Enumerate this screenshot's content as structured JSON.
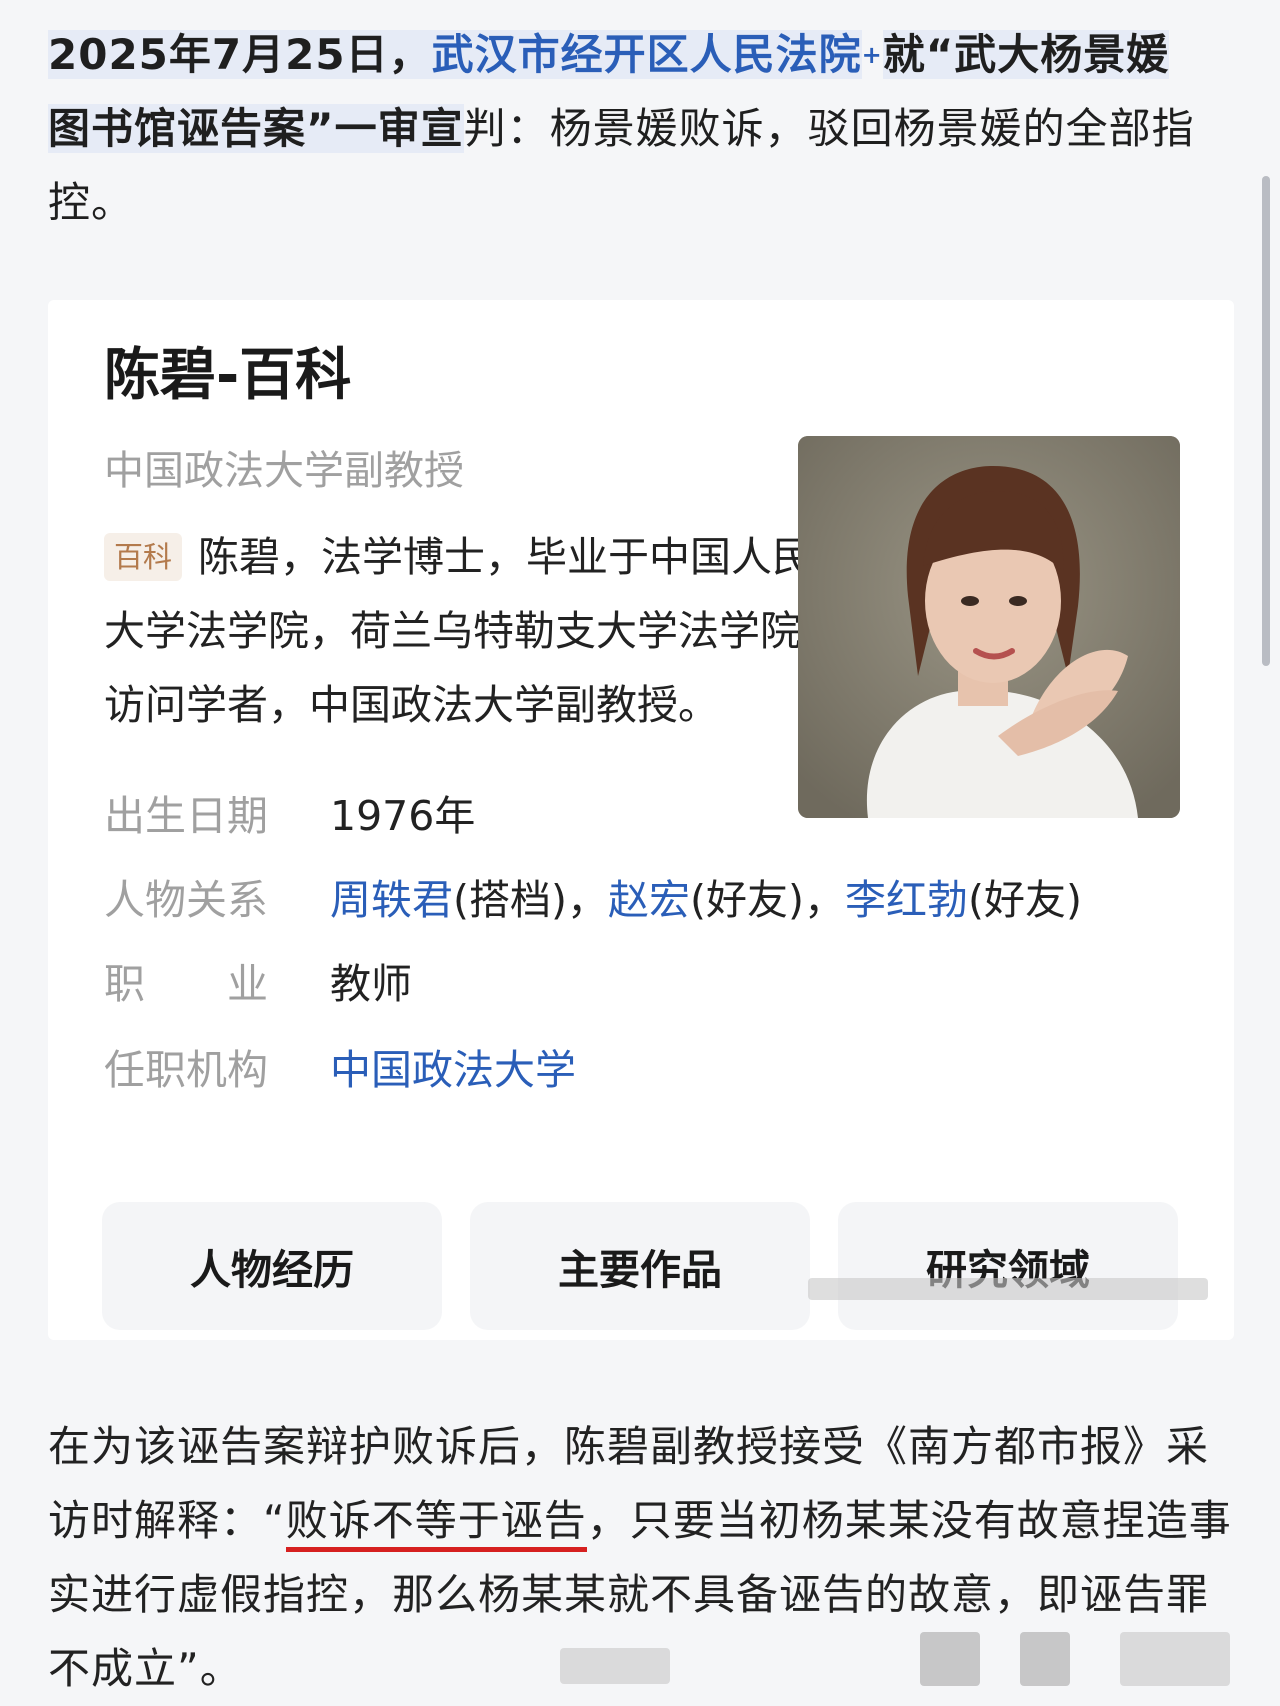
{
  "intro": {
    "date": "2025年7月25日，",
    "court_link": "武汉市经开区人民法院",
    "sup": "+",
    "case_prefix": "就“武大杨景媛",
    "case_line2": "图书馆诬告案”一审宣",
    "tail": "判：杨景媛败诉，驳回杨景媛的全部指控。"
  },
  "card": {
    "title": "陈碧-百科",
    "subtitle": "中国政法大学副教授",
    "tag": "百科",
    "description": "陈碧，法学博士，毕业于中国人民大学法学院，荷兰乌特勒支大学法学院访问学者，中国政法大学副教授。",
    "birth": {
      "label": "出生日期",
      "value": "1976年"
    },
    "relations": {
      "label": "人物关系",
      "items": [
        {
          "name": "周轶君",
          "relation": "(搭档)",
          "sep": "，"
        },
        {
          "name": "赵宏",
          "relation": "(好友)",
          "sep": "，"
        },
        {
          "name": "李红勃",
          "relation": "(好友)",
          "sep": ""
        }
      ]
    },
    "job": {
      "label": "职　　业",
      "value": "教师"
    },
    "org": {
      "label": "任职机构",
      "value": "中国政法大学"
    },
    "buttons": [
      "人物经历",
      "主要作品",
      "研究领域"
    ]
  },
  "paragraph": {
    "before": "在为该诬告案辩护败诉后，陈碧副教授接受《南方都市报》采访时解释：“",
    "highlight": "败诉不等于诬告",
    "after": "，只要当初杨某某没有故意捏造事实进行虚假指控，那么杨某某就不具备诬告的故意，即诬告罪不成立”。"
  },
  "colors": {
    "link": "#2a5eb8",
    "underline": "#d62020",
    "tag": "#b37a4c"
  }
}
